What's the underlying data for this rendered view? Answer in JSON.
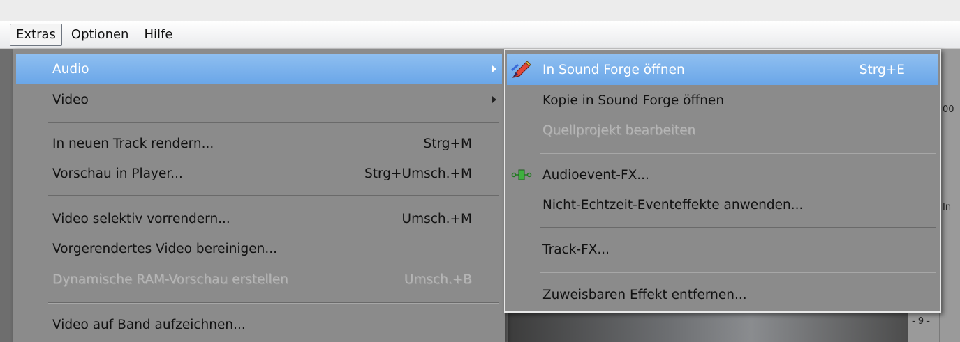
{
  "menubar": {
    "items": [
      {
        "label": "Extras",
        "active": true
      },
      {
        "label": "Optionen",
        "active": false
      },
      {
        "label": "Hilfe",
        "active": false
      }
    ]
  },
  "extras_menu": {
    "items": [
      {
        "label": "Audio",
        "shortcut": "",
        "submenu": true,
        "highlighted": true,
        "disabled": false
      },
      {
        "label": "Video",
        "shortcut": "",
        "submenu": true,
        "highlighted": false,
        "disabled": false
      },
      {
        "label": "In neuen Track rendern...",
        "shortcut": "Strg+M",
        "disabled": false
      },
      {
        "label": "Vorschau in Player...",
        "shortcut": "Strg+Umsch.+M",
        "disabled": false
      },
      {
        "label": "Video selektiv vorrendern...",
        "shortcut": "Umsch.+M",
        "disabled": false
      },
      {
        "label": "Vorgerendertes Video bereinigen...",
        "shortcut": "",
        "disabled": false
      },
      {
        "label": "Dynamische RAM-Vorschau erstellen",
        "shortcut": "Umsch.+B",
        "disabled": true
      },
      {
        "label": "Video auf Band aufzeichnen...",
        "shortcut": "",
        "disabled": false
      }
    ]
  },
  "audio_submenu": {
    "items": [
      {
        "label": "In Sound Forge öffnen",
        "shortcut": "Strg+E",
        "highlighted": true,
        "icon": "sound-forge-pen-icon",
        "disabled": false
      },
      {
        "label": "Kopie in Sound Forge öffnen",
        "shortcut": "",
        "disabled": false
      },
      {
        "label": "Quellprojekt bearbeiten",
        "shortcut": "",
        "disabled": true
      },
      {
        "label": "Audioevent-FX...",
        "shortcut": "",
        "icon": "audio-fx-plug-icon",
        "disabled": false
      },
      {
        "label": "Nicht-Echtzeit-Eventeffekte anwenden...",
        "shortcut": "",
        "disabled": false
      },
      {
        "label": "Track-FX...",
        "shortcut": "",
        "disabled": false
      },
      {
        "label": "Zuweisbaren Effekt entfernen...",
        "shortcut": "",
        "disabled": false
      }
    ]
  },
  "background": {
    "right_ticks": [
      "00",
      "In",
      "- 9 -"
    ]
  },
  "colors": {
    "highlight": "#6aa6e8",
    "menu_bg": "#8b8b8b",
    "menubar_bg": "#ffffff"
  }
}
